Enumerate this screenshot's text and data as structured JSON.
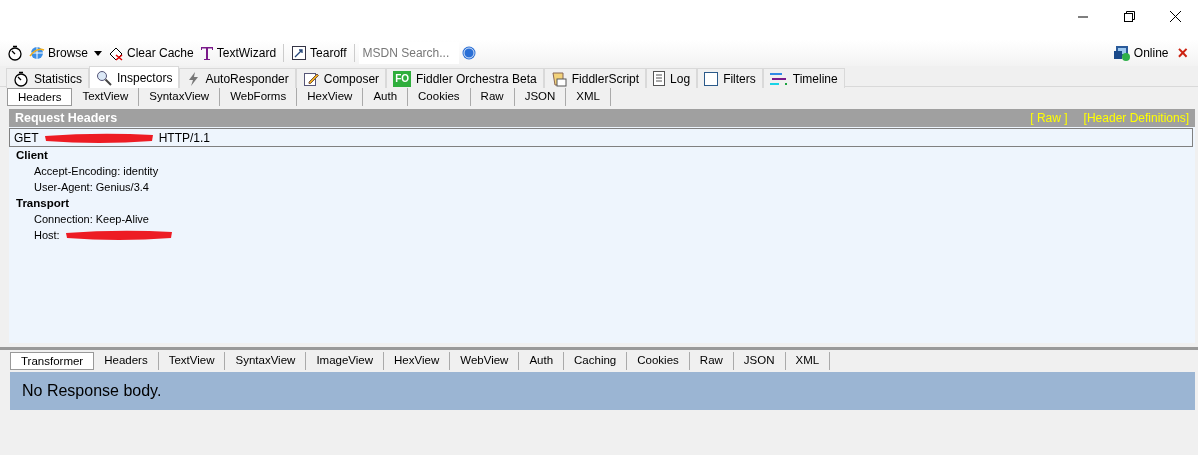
{
  "toolbar": [
    {
      "kind": "stopwatch"
    },
    {
      "kind": "browse",
      "label": "Browse"
    },
    {
      "kind": "dropdown"
    },
    {
      "kind": "clear",
      "label": "Clear Cache"
    },
    {
      "kind": "textwizard",
      "label": "TextWizard"
    },
    {
      "kind": "sep"
    },
    {
      "kind": "tearoff",
      "label": "Tearoff"
    },
    {
      "kind": "sep"
    },
    {
      "kind": "search",
      "placeholder": "MSDN Search..."
    },
    {
      "kind": "help"
    }
  ],
  "online": {
    "label": "Online",
    "close": "×"
  },
  "tabs": [
    {
      "label": "Statistics",
      "selected": false
    },
    {
      "label": "Inspectors",
      "selected": true
    },
    {
      "label": "AutoResponder",
      "selected": false
    },
    {
      "label": "Composer",
      "selected": false
    },
    {
      "label": "Fiddler Orchestra Beta",
      "icon_text": "FO",
      "selected": false
    },
    {
      "label": "FiddlerScript",
      "selected": false
    },
    {
      "label": "Log",
      "selected": false
    },
    {
      "label": "Filters",
      "selected": false
    },
    {
      "label": "Timeline",
      "selected": false
    }
  ],
  "request_tabs": [
    {
      "label": "Headers",
      "selected": true
    },
    {
      "label": "TextView",
      "selected": false
    },
    {
      "label": "SyntaxView",
      "selected": false
    },
    {
      "label": "WebForms",
      "selected": false
    },
    {
      "label": "HexView",
      "selected": false
    },
    {
      "label": "Auth",
      "selected": false
    },
    {
      "label": "Cookies",
      "selected": false
    },
    {
      "label": "Raw",
      "selected": false
    },
    {
      "label": "JSON",
      "selected": false
    },
    {
      "label": "XML",
      "selected": false
    }
  ],
  "request_headers": {
    "title": "Request Headers",
    "links": [
      "[ Raw ]",
      "[Header Definitions]"
    ],
    "method": "GET",
    "protocol": "HTTP/1.1",
    "groups": [
      {
        "name": "Client",
        "headers": [
          {
            "text": "Accept-Encoding: identity"
          },
          {
            "text": "User-Agent: Genius/3.4"
          }
        ]
      },
      {
        "name": "Transport",
        "headers": [
          {
            "text": "Connection: Keep-Alive"
          },
          {
            "text": "Host:",
            "redacted": true
          }
        ]
      }
    ]
  },
  "response_tabs": [
    {
      "label": "Transformer",
      "selected": true
    },
    {
      "label": "Headers",
      "selected": false
    },
    {
      "label": "TextView",
      "selected": false
    },
    {
      "label": "SyntaxView",
      "selected": false
    },
    {
      "label": "ImageView",
      "selected": false
    },
    {
      "label": "HexView",
      "selected": false
    },
    {
      "label": "WebView",
      "selected": false
    },
    {
      "label": "Auth",
      "selected": false
    },
    {
      "label": "Caching",
      "selected": false
    },
    {
      "label": "Cookies",
      "selected": false
    },
    {
      "label": "Raw",
      "selected": false
    },
    {
      "label": "JSON",
      "selected": false
    },
    {
      "label": "XML",
      "selected": false
    }
  ],
  "response_message": "No Response body."
}
